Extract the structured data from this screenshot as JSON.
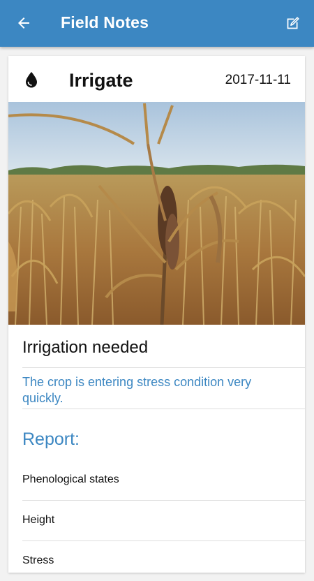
{
  "appbar": {
    "title": "Field Notes",
    "back_icon": "arrow-left-icon",
    "edit_icon": "edit-note-icon",
    "color": "#3c87c2"
  },
  "note": {
    "type_icon": "water-drop-icon",
    "type": "Irrigate",
    "date": "2017-11-11",
    "photo_subject": "dry corn field",
    "title": "Irrigation needed",
    "description": "The crop is entering stress condition very quickly."
  },
  "report": {
    "heading": "Report:",
    "items": [
      {
        "label": "Phenological states"
      },
      {
        "label": "Height"
      },
      {
        "label": "Stress"
      }
    ]
  }
}
